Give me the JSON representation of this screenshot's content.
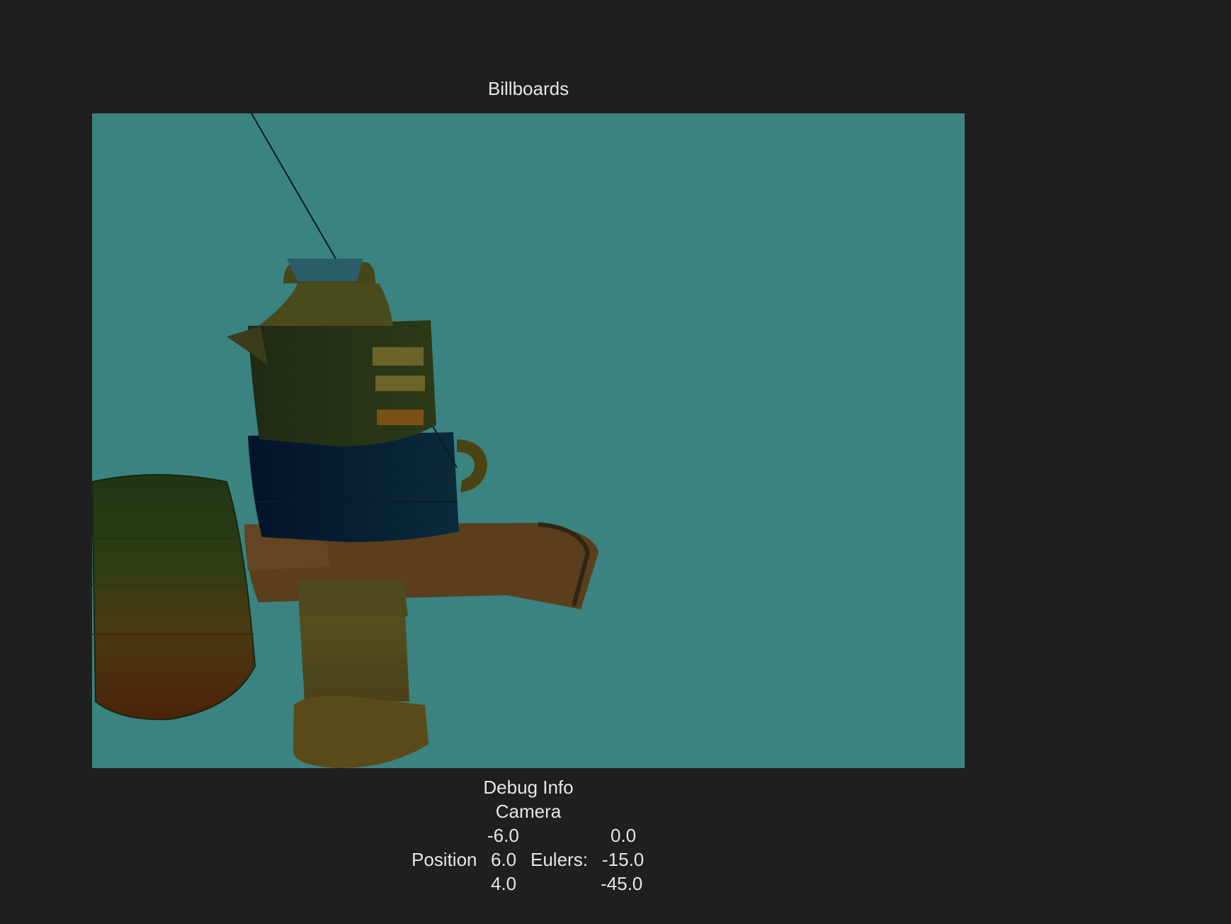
{
  "window": {
    "title": "Billboards"
  },
  "viewport": {
    "background_color": "#3a8380"
  },
  "debug": {
    "heading": "Debug Info",
    "section": "Camera",
    "position_label": "Position",
    "eulers_label": "Eulers:",
    "position": [
      "-6.0",
      "6.0",
      "4.0"
    ],
    "eulers": [
      "0.0",
      "-15.0",
      "-45.0"
    ]
  }
}
